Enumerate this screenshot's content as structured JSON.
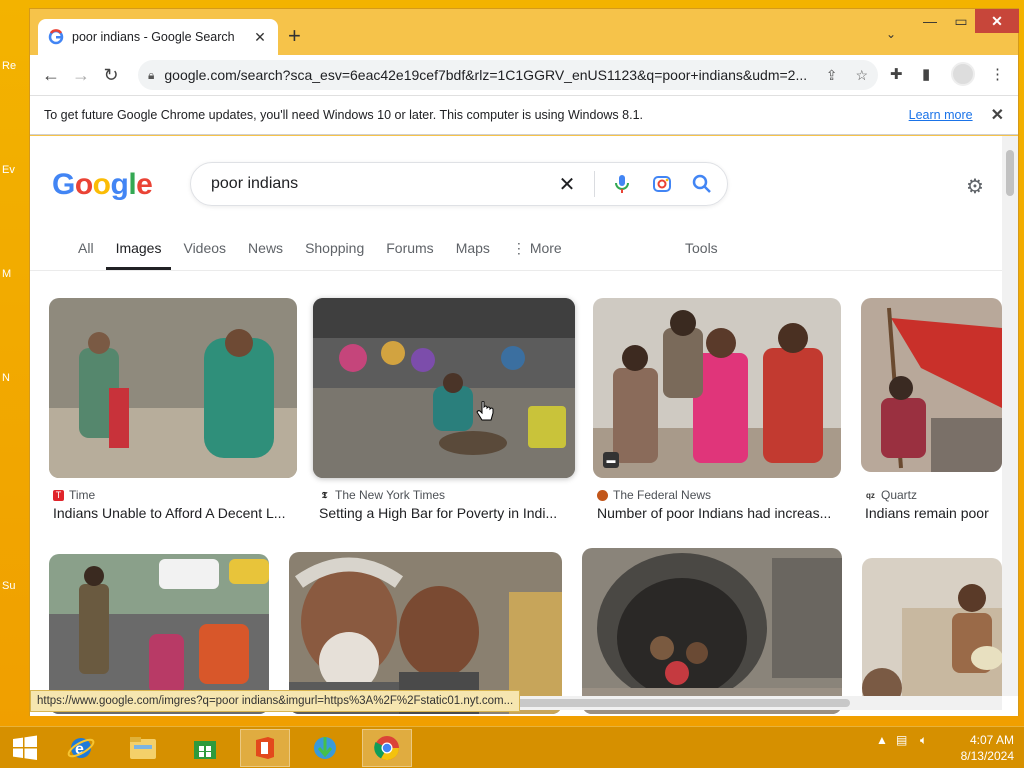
{
  "desktop": {
    "labels": [
      "Re",
      "Ev",
      "M",
      "N",
      "Su"
    ]
  },
  "browser": {
    "tab_title": "poor indians - Google Search",
    "url": "google.com/search?sca_esv=6eac42e19cef7bdf&rlz=1C1GGRV_enUS1123&q=poor+indians&udm=2...",
    "infobar_text": "To get future Google Chrome updates, you'll need Windows 10 or later. This computer is using Windows 8.1.",
    "infobar_link": "Learn more",
    "status_url": "https://www.google.com/imgres?q=poor indians&imgurl=https%3A%2F%2Fstatic01.nyt.com..."
  },
  "google": {
    "logo": [
      "G",
      "o",
      "o",
      "g",
      "l",
      "e"
    ],
    "logo_colors": [
      "#4285F4",
      "#EA4335",
      "#FBBC05",
      "#4285F4",
      "#34A853",
      "#EA4335"
    ],
    "query": "poor indians",
    "tabs": [
      "All",
      "Images",
      "Videos",
      "News",
      "Shopping",
      "Forums",
      "Maps",
      "More"
    ],
    "active_tab": "Images",
    "tools": "Tools"
  },
  "results": [
    {
      "source": "Time",
      "title": "Indians Unable to Afford A Decent L...",
      "icon_color": "#e0242b"
    },
    {
      "source": "The New York Times",
      "title": "Setting a High Bar for Poverty in Indi...",
      "icon_color": "#222222"
    },
    {
      "source": "The Federal News",
      "title": "Number of poor Indians had increas...",
      "icon_color": "#c2561a"
    },
    {
      "source": "Quartz",
      "title": "Indians remain poor",
      "icon_color": "#333333"
    }
  ],
  "taskbar": {
    "time": "4:07 AM",
    "date": "8/13/2024"
  },
  "colors": {
    "accent": "#1a73e8",
    "desktop": "#f0a400"
  }
}
